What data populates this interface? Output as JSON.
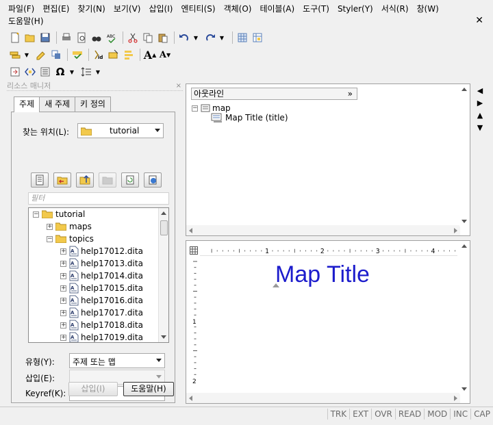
{
  "menu": {
    "row1": [
      "파일(F)",
      "편집(E)",
      "찾기(N)",
      "보기(V)",
      "삽입(I)",
      "엔티티(S)",
      "객체(O)",
      "테이블(A)",
      "도구(T)",
      "Styler(Y)",
      "서식(R)",
      "창(W)"
    ],
    "row2": [
      "도움말(H)"
    ],
    "close": "✕"
  },
  "resource_manager": {
    "title": "리소스 매니저",
    "close": "×",
    "tabs": [
      "주제",
      "새 주제",
      "키 정의"
    ],
    "look_in_label": "찾는 위치(L):",
    "look_in_value": "tutorial",
    "filter_placeholder": "필터",
    "tree": {
      "root": "tutorial",
      "maps": "maps",
      "topics": "topics",
      "files": [
        "help17012.dita",
        "help17013.dita",
        "help17014.dita",
        "help17015.dita",
        "help17016.dita",
        "help17017.dita",
        "help17018.dita",
        "help17019.dita"
      ]
    },
    "type_label": "유형(Y):",
    "type_value": "주제 또는 맵",
    "insert_label": "삽입(E):",
    "insert_value": "",
    "keyref_label": "Keyref(K):",
    "keyref_value": "",
    "insert_button": "삽입(I)",
    "help_button": "도움말(H)"
  },
  "outline": {
    "header": "아웃라인",
    "expand": "»",
    "root": "map",
    "child": "Map Title (title)"
  },
  "editor": {
    "title_text": "Map Title",
    "ruler_labels": [
      "1",
      "2",
      "3",
      "4"
    ],
    "vruler_labels": [
      "1",
      "2"
    ]
  },
  "status": [
    "TRK",
    "EXT",
    "OVR",
    "READ",
    "MOD",
    "INC",
    "CAP"
  ],
  "colors": {
    "title_blue": "#1c1ccc",
    "folder_yellow": "#f2c94c",
    "panel_bg": "#f0f0f0"
  }
}
